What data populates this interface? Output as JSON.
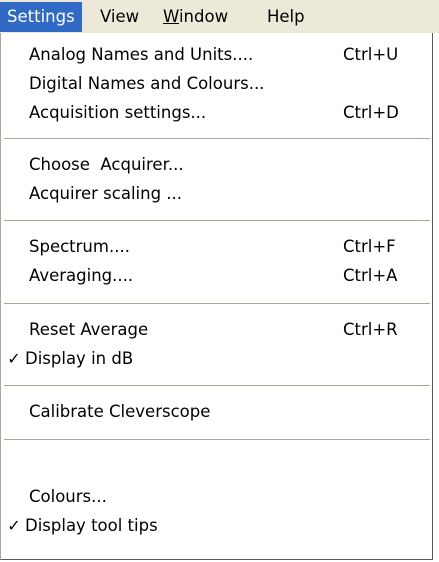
{
  "menubar": {
    "items": [
      {
        "label": "Settings"
      },
      {
        "label": "View"
      },
      {
        "label_prefix": "",
        "mnemonic": "W",
        "label_suffix": "indow"
      },
      {
        "label": "Help"
      }
    ]
  },
  "menu": {
    "items": [
      {
        "label": "Analog Names and Units....",
        "shortcut": "Ctrl+U",
        "checked": false
      },
      {
        "label": "Digital Names and Colours...",
        "shortcut": "",
        "checked": false
      },
      {
        "label": "Acquisition settings...",
        "shortcut": "Ctrl+D",
        "checked": false
      },
      {
        "label": "Choose  Acquirer...",
        "shortcut": "",
        "checked": false
      },
      {
        "label": "Acquirer scaling ...",
        "shortcut": "",
        "checked": false
      },
      {
        "label": "Spectrum....",
        "shortcut": "Ctrl+F",
        "checked": false
      },
      {
        "label": "Averaging....",
        "shortcut": "Ctrl+A",
        "checked": false
      },
      {
        "label": "Reset Average",
        "shortcut": "Ctrl+R",
        "checked": false
      },
      {
        "label": "Display in dB",
        "shortcut": "",
        "checked": true,
        "check_mark": "✓"
      },
      {
        "label": "Calibrate Cleverscope",
        "shortcut": "",
        "checked": false
      },
      {
        "label": "Colours...",
        "shortcut": "",
        "checked": false
      },
      {
        "label": "Display tool tips",
        "shortcut": "",
        "checked": true,
        "check_mark": "✓"
      }
    ]
  },
  "colors": {
    "menubar_bg": "#ece9d8",
    "highlight": "#316ac5",
    "menu_bg": "#ffffff",
    "separator": "#aca899"
  }
}
